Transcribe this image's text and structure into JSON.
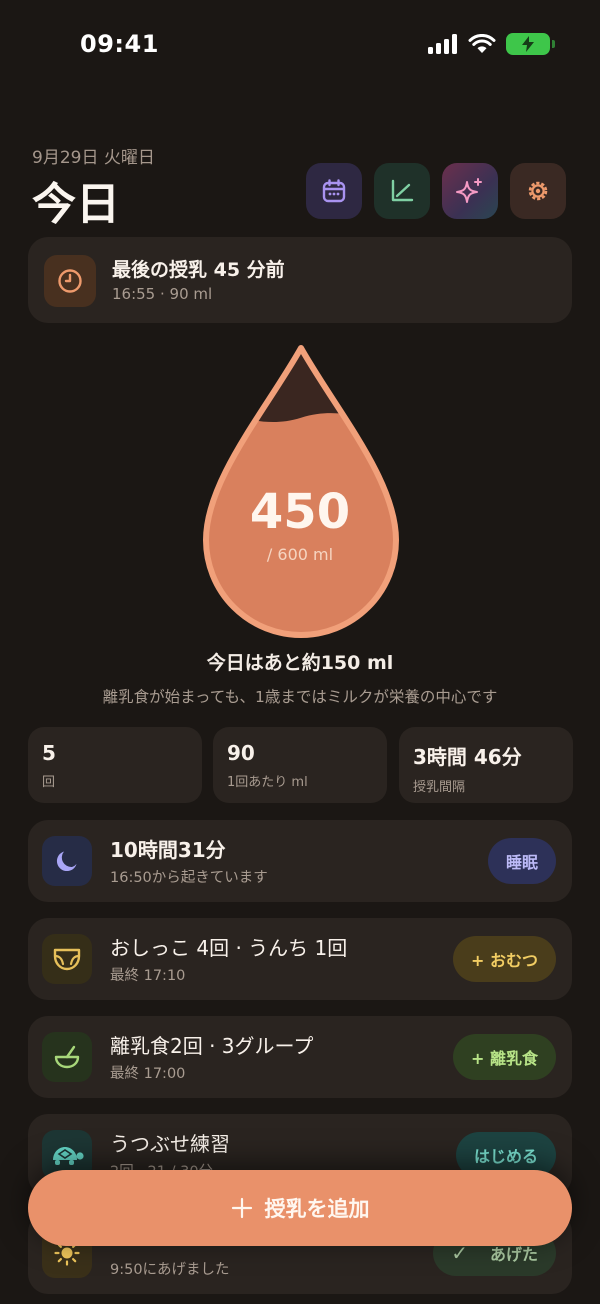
{
  "status": {
    "time": "09:41"
  },
  "header": {
    "date": "9月29日 火曜日",
    "title": "今日"
  },
  "last_feed": {
    "title": "最後の授乳 45 分前",
    "detail": "16:55 · 90 ml"
  },
  "intake": {
    "value": "450",
    "total": "/ 600 ml",
    "progress": 0.75,
    "remaining": "今日はあと約150 ml",
    "hint": "離乳食が始まっても、1歳まではミルクが栄養の中心です"
  },
  "stats": [
    {
      "value": "5",
      "label": "回"
    },
    {
      "value": "90",
      "label": "1回あたり ml"
    },
    {
      "value": "3時間 46分",
      "label": "授乳間隔"
    }
  ],
  "sleep": {
    "title": "10時間31分",
    "sub": "16:50から起きています",
    "button": "睡眠"
  },
  "diaper": {
    "title": "おしっこ 4回 · うんち 1回",
    "sub": "最終 17:10",
    "button": "+ おむつ"
  },
  "food": {
    "title": "離乳食2回 · 3グループ",
    "sub": "最終 17:00",
    "button": "+ 離乳食"
  },
  "tummy": {
    "title": "うつぶせ練習",
    "sub": "2回 · 21 / 30分",
    "button": "はじめる"
  },
  "vitd": {
    "sub": "9:50にあげました",
    "button": "あげた"
  },
  "add_feed": {
    "label": "授乳を追加"
  },
  "colors": {
    "accent": "#e9916a",
    "background": "#1b1714",
    "card": "#2a2420"
  }
}
